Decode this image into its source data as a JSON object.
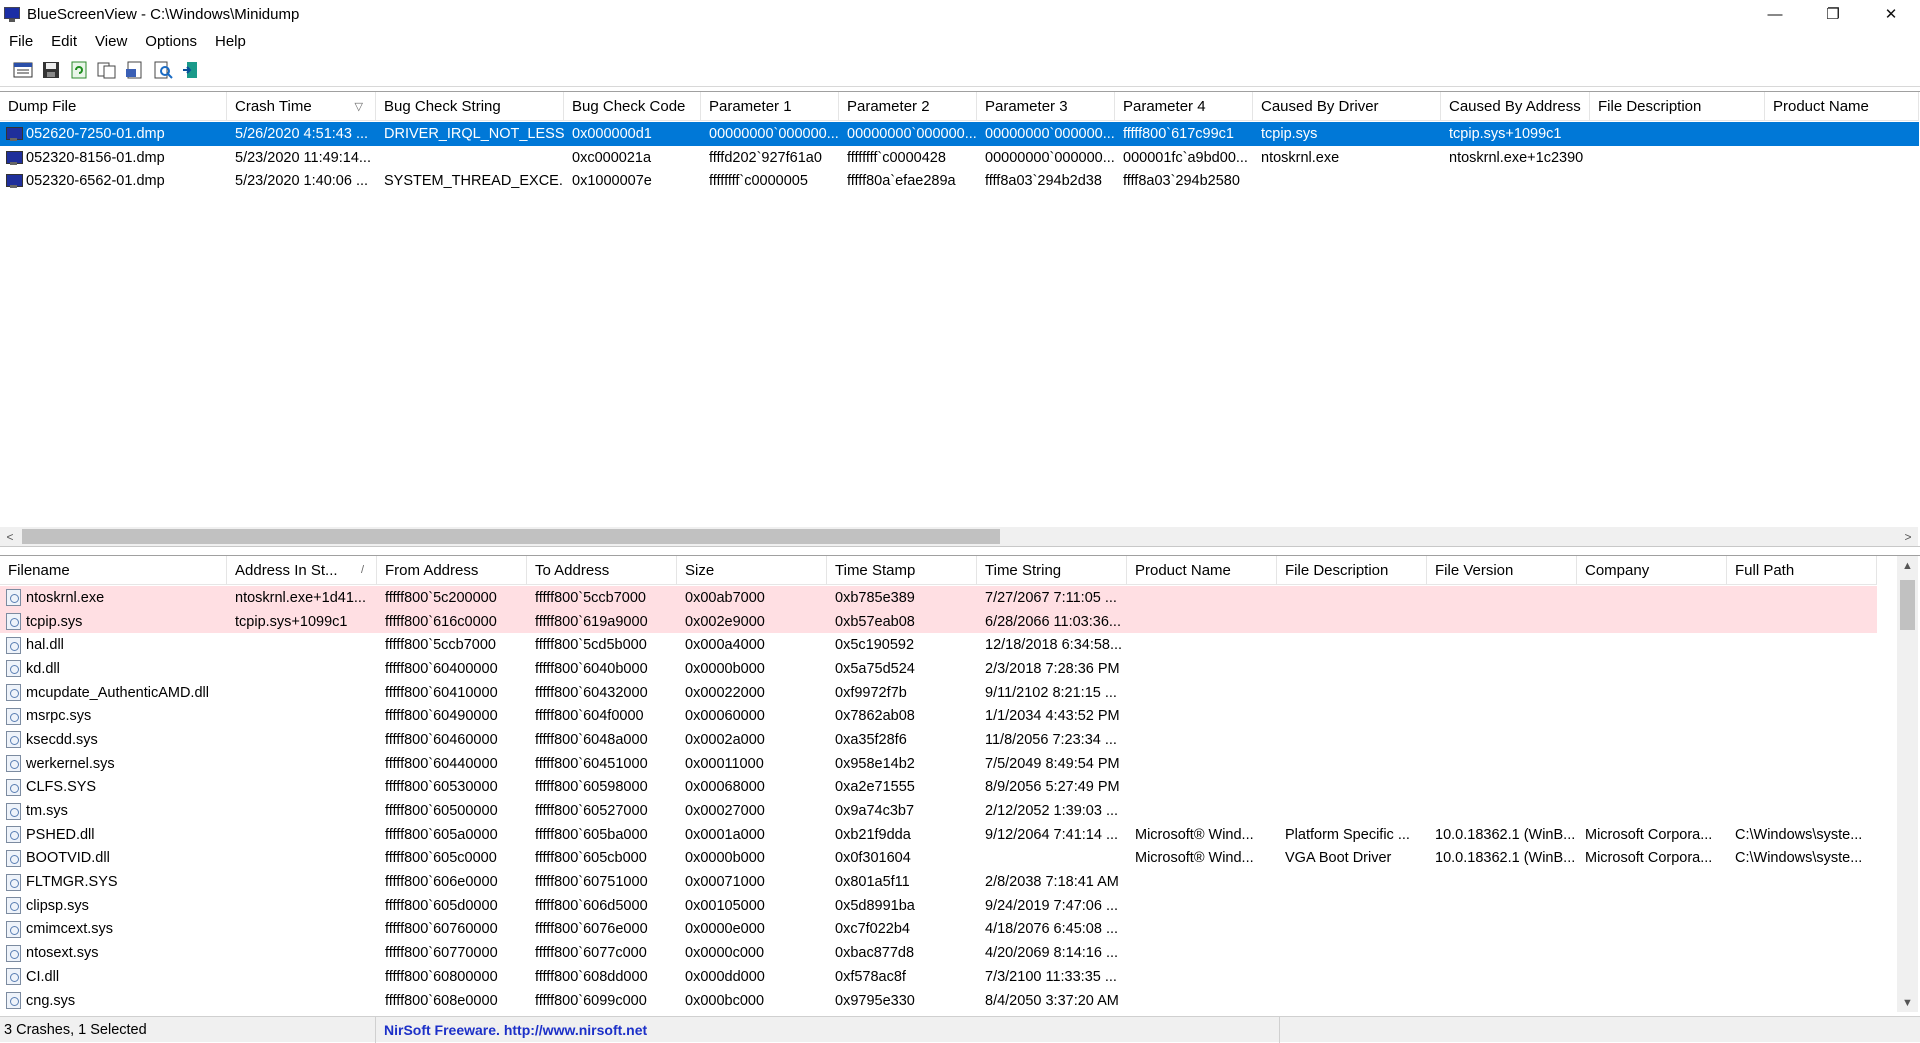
{
  "window": {
    "app_name": "BlueScreenView",
    "title": "BlueScreenView  -  C:\\Windows\\Minidump",
    "minimize": "—",
    "restore": "❐",
    "close": "✕"
  },
  "menu": [
    "File",
    "Edit",
    "View",
    "Options",
    "Help"
  ],
  "toolbar": [
    "properties-icon",
    "save-icon",
    "refresh-icon",
    "copy-icon",
    "html-report-icon",
    "find-icon",
    "exit-icon"
  ],
  "crashes": {
    "columns": [
      "Dump File",
      "Crash Time",
      "Bug Check String",
      "Bug Check Code",
      "Parameter 1",
      "Parameter 2",
      "Parameter 3",
      "Parameter 4",
      "Caused By Driver",
      "Caused By Address",
      "File Description",
      "Product Name"
    ],
    "sorted_column_indicator": "▽",
    "rows": [
      [
        "052620-7250-01.dmp",
        "5/26/2020 4:51:43 ...",
        "DRIVER_IRQL_NOT_LESS...",
        "0x000000d1",
        "00000000`000000...",
        "00000000`000000...",
        "00000000`000000...",
        "fffff800`617c99c1",
        "tcpip.sys",
        "tcpip.sys+1099c1",
        "",
        ""
      ],
      [
        "052320-8156-01.dmp",
        "5/23/2020 11:49:14...",
        "",
        "0xc000021a",
        "ffffd202`927f61a0",
        "ffffffff`c0000428",
        "00000000`000000...",
        "000001fc`a9bd00...",
        "ntoskrnl.exe",
        "ntoskrnl.exe+1c2390",
        "",
        ""
      ],
      [
        "052320-6562-01.dmp",
        "5/23/2020 1:40:06 ...",
        "SYSTEM_THREAD_EXCE...",
        "0x1000007e",
        "ffffffff`c0000005",
        "fffff80a`efae289a",
        "ffff8a03`294b2d38",
        "ffff8a03`294b2580",
        "",
        "",
        "",
        ""
      ]
    ]
  },
  "drivers": {
    "columns": [
      "Filename",
      "Address In St...",
      "From Address",
      "To Address",
      "Size",
      "Time Stamp",
      "Time String",
      "Product Name",
      "File Description",
      "File Version",
      "Company",
      "Full Path"
    ],
    "sorted_column_indicator": "/",
    "rows": [
      [
        "ntoskrnl.exe",
        "ntoskrnl.exe+1d41...",
        "fffff800`5c200000",
        "fffff800`5ccb7000",
        "0x00ab7000",
        "0xb785e389",
        "7/27/2067 7:11:05 ...",
        "",
        "",
        "",
        "",
        ""
      ],
      [
        "tcpip.sys",
        "tcpip.sys+1099c1",
        "fffff800`616c0000",
        "fffff800`619a9000",
        "0x002e9000",
        "0xb57eab08",
        "6/28/2066 11:03:36...",
        "",
        "",
        "",
        "",
        ""
      ],
      [
        "hal.dll",
        "",
        "fffff800`5ccb7000",
        "fffff800`5cd5b000",
        "0x000a4000",
        "0x5c190592",
        "12/18/2018 6:34:58...",
        "",
        "",
        "",
        "",
        ""
      ],
      [
        "kd.dll",
        "",
        "fffff800`60400000",
        "fffff800`6040b000",
        "0x0000b000",
        "0x5a75d524",
        "2/3/2018 7:28:36 PM",
        "",
        "",
        "",
        "",
        ""
      ],
      [
        "mcupdate_AuthenticAMD.dll",
        "",
        "fffff800`60410000",
        "fffff800`60432000",
        "0x00022000",
        "0xf9972f7b",
        "9/11/2102 8:21:15 ...",
        "",
        "",
        "",
        "",
        ""
      ],
      [
        "msrpc.sys",
        "",
        "fffff800`60490000",
        "fffff800`604f0000",
        "0x00060000",
        "0x7862ab08",
        "1/1/2034 4:43:52 PM",
        "",
        "",
        "",
        "",
        ""
      ],
      [
        "ksecdd.sys",
        "",
        "fffff800`60460000",
        "fffff800`6048a000",
        "0x0002a000",
        "0xa35f28f6",
        "11/8/2056 7:23:34 ...",
        "",
        "",
        "",
        "",
        ""
      ],
      [
        "werkernel.sys",
        "",
        "fffff800`60440000",
        "fffff800`60451000",
        "0x00011000",
        "0x958e14b2",
        "7/5/2049 8:49:54 PM",
        "",
        "",
        "",
        "",
        ""
      ],
      [
        "CLFS.SYS",
        "",
        "fffff800`60530000",
        "fffff800`60598000",
        "0x00068000",
        "0xa2e71555",
        "8/9/2056 5:27:49 PM",
        "",
        "",
        "",
        "",
        ""
      ],
      [
        "tm.sys",
        "",
        "fffff800`60500000",
        "fffff800`60527000",
        "0x00027000",
        "0x9a74c3b7",
        "2/12/2052 1:39:03 ...",
        "",
        "",
        "",
        "",
        ""
      ],
      [
        "PSHED.dll",
        "",
        "fffff800`605a0000",
        "fffff800`605ba000",
        "0x0001a000",
        "0xb21f9dda",
        "9/12/2064 7:41:14 ...",
        "Microsoft® Wind...",
        "Platform Specific ...",
        "10.0.18362.1 (WinB...",
        "Microsoft Corpora...",
        "C:\\Windows\\syste..."
      ],
      [
        "BOOTVID.dll",
        "",
        "fffff800`605c0000",
        "fffff800`605cb000",
        "0x0000b000",
        "0x0f301604",
        "",
        "Microsoft® Wind...",
        "VGA Boot Driver",
        "10.0.18362.1 (WinB...",
        "Microsoft Corpora...",
        "C:\\Windows\\syste..."
      ],
      [
        "FLTMGR.SYS",
        "",
        "fffff800`606e0000",
        "fffff800`60751000",
        "0x00071000",
        "0x801a5f11",
        "2/8/2038 7:18:41 AM",
        "",
        "",
        "",
        "",
        ""
      ],
      [
        "clipsp.sys",
        "",
        "fffff800`605d0000",
        "fffff800`606d5000",
        "0x00105000",
        "0x5d8991ba",
        "9/24/2019 7:47:06 ...",
        "",
        "",
        "",
        "",
        ""
      ],
      [
        "cmimcext.sys",
        "",
        "fffff800`60760000",
        "fffff800`6076e000",
        "0x0000e000",
        "0xc7f022b4",
        "4/18/2076 6:45:08 ...",
        "",
        "",
        "",
        "",
        ""
      ],
      [
        "ntosext.sys",
        "",
        "fffff800`60770000",
        "fffff800`6077c000",
        "0x0000c000",
        "0xbac877d8",
        "4/20/2069 8:14:16 ...",
        "",
        "",
        "",
        "",
        ""
      ],
      [
        "CI.dll",
        "",
        "fffff800`60800000",
        "fffff800`608dd000",
        "0x000dd000",
        "0xf578ac8f",
        "7/3/2100 11:33:35 ...",
        "",
        "",
        "",
        "",
        ""
      ],
      [
        "cng.sys",
        "",
        "fffff800`608e0000",
        "fffff800`6099c000",
        "0x000bc000",
        "0x9795e330",
        "8/4/2050 3:37:20 AM",
        "",
        "",
        "",
        "",
        ""
      ]
    ]
  },
  "status": {
    "count_text": "3 Crashes, 1 Selected",
    "freeware_text": "NirSoft Freeware.  http://www.nirsoft.net"
  },
  "colors": {
    "selection": "#0078d7",
    "highlight_row": "#ffdfe3",
    "link": "#1c30c8"
  }
}
